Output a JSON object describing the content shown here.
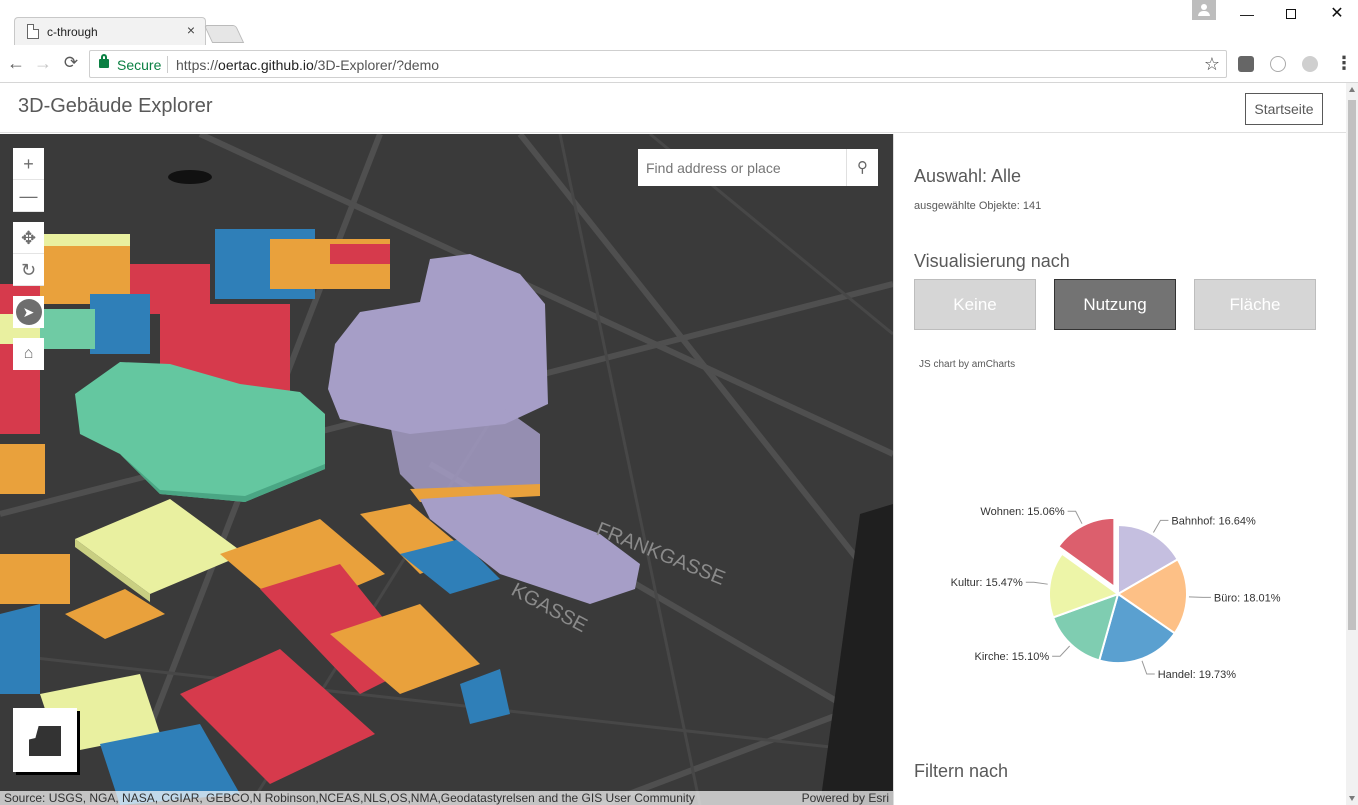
{
  "browser": {
    "tab_title": "c-through",
    "tab_close": "×",
    "win_min": "—",
    "win_close": "✕",
    "nav_back": "←",
    "nav_forward": "→",
    "nav_reload": "⟳",
    "secure_label": "Secure",
    "url_scheme": "https://",
    "url_host": "oertac.github.io",
    "url_path": "/3D-Explorer/?demo",
    "star": "☆",
    "menu": "⋮"
  },
  "header": {
    "title": "3D-Gebäude Explorer",
    "home_button": "Startseite"
  },
  "map": {
    "zoom_in": "+",
    "zoom_out": "—",
    "pan": "✥",
    "rotate": "↻",
    "compass": "➤",
    "home": "⌂",
    "search_placeholder": "Find address or place",
    "search_icon": "⚲",
    "street_labels": [
      "FRANKGASSE",
      "KGASSE"
    ],
    "attribution_source": "Source: USGS, NGA, NASA, CGIAR, GEBCO,N Robinson,NCEAS,NLS,OS,NMA,Geodatastyrelsen and the GIS User Community",
    "attribution_powered": "Powered by Esri"
  },
  "panel": {
    "selection_title": "Auswahl: Alle",
    "selection_count": "ausgewählte Objekte: 141",
    "viz_title": "Visualisierung nach",
    "viz_buttons": {
      "none": "Keine",
      "usage": "Nutzung",
      "area": "Fläche"
    },
    "chart_credit": "JS chart by amCharts",
    "filter_title": "Filtern nach"
  },
  "chart_data": {
    "type": "pie",
    "categories": [
      "Bahnhof",
      "Büro",
      "Handel",
      "Kirche",
      "Kultur",
      "Wohnen"
    ],
    "values": [
      16.64,
      18.01,
      19.73,
      15.1,
      15.47,
      15.06
    ],
    "labels": [
      "Bahnhof: 16.64%",
      "Büro: 18.01%",
      "Handel: 19.73%",
      "Kirche: 15.10%",
      "Kultur: 15.47%",
      "Wohnen: 15.06%"
    ],
    "colors": [
      "#c5bfe0",
      "#fdc086",
      "#5aa0d0",
      "#7fcdb1",
      "#edf5a8",
      "#dc5f6d"
    ],
    "pulled_out": "Wohnen"
  }
}
